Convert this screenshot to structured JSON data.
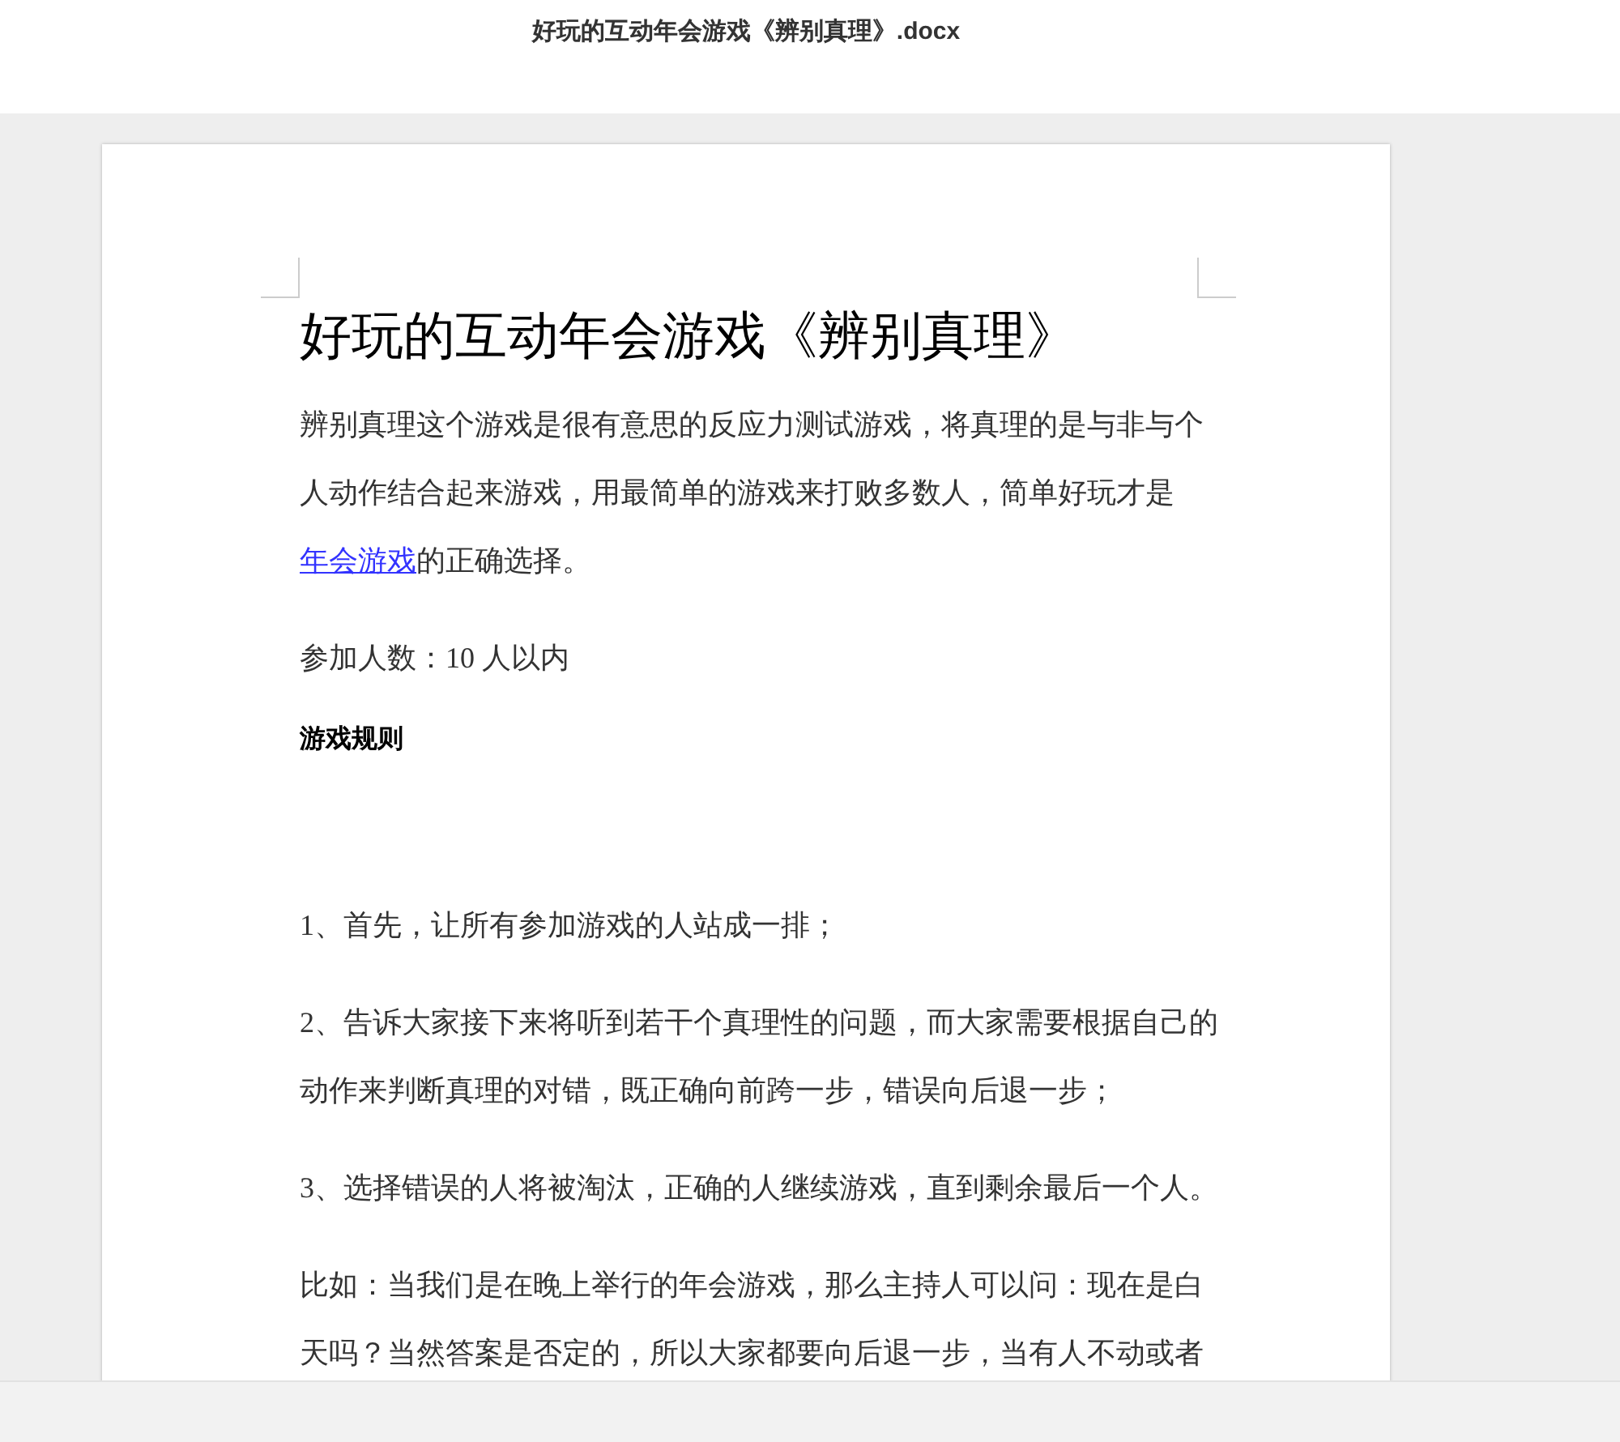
{
  "file_title": "好玩的互动年会游戏《辨别真理》.docx",
  "document": {
    "heading": "好玩的互动年会游戏《辨别真理》",
    "blocks": [
      {
        "kind": "paragraph",
        "parts": [
          {
            "kind": "text",
            "text": "辨别真理这个游戏是很有意思的反应力测试游戏，将真理的是与非与个人动作结合起来游戏，用最简单的游戏来打败多数人，简单好玩才是"
          },
          {
            "kind": "link",
            "text": "年会游戏"
          },
          {
            "kind": "text",
            "text": "的正确选择。"
          }
        ]
      },
      {
        "kind": "paragraph",
        "parts": [
          {
            "kind": "text",
            "text": "参加人数：10 人以内"
          }
        ]
      },
      {
        "kind": "subheading",
        "parts": [
          {
            "kind": "text",
            "text": "游戏规则"
          }
        ]
      },
      {
        "kind": "paragraph",
        "parts": [
          {
            "kind": "text",
            "text": "1、首先，让所有参加游戏的人站成一排；"
          }
        ]
      },
      {
        "kind": "paragraph",
        "parts": [
          {
            "kind": "text",
            "text": "2、告诉大家接下来将听到若干个真理性的问题，而大家需要根据自己的动作来判断真理的对错，既正确向前跨一步，错误向后退一步；"
          }
        ]
      },
      {
        "kind": "paragraph",
        "parts": [
          {
            "kind": "text",
            "text": "3、选择错误的人将被淘汰，正确的人继续游戏，直到剩余最后一个人。"
          }
        ]
      },
      {
        "kind": "paragraph",
        "parts": [
          {
            "kind": "text",
            "text": "比如：当我们是在晚上举行的年会游戏，那么主持人可以问：现在是白天吗？当然答案是否定的，所以大家都要向后退一步，当有人不动或者"
          }
        ]
      }
    ]
  }
}
